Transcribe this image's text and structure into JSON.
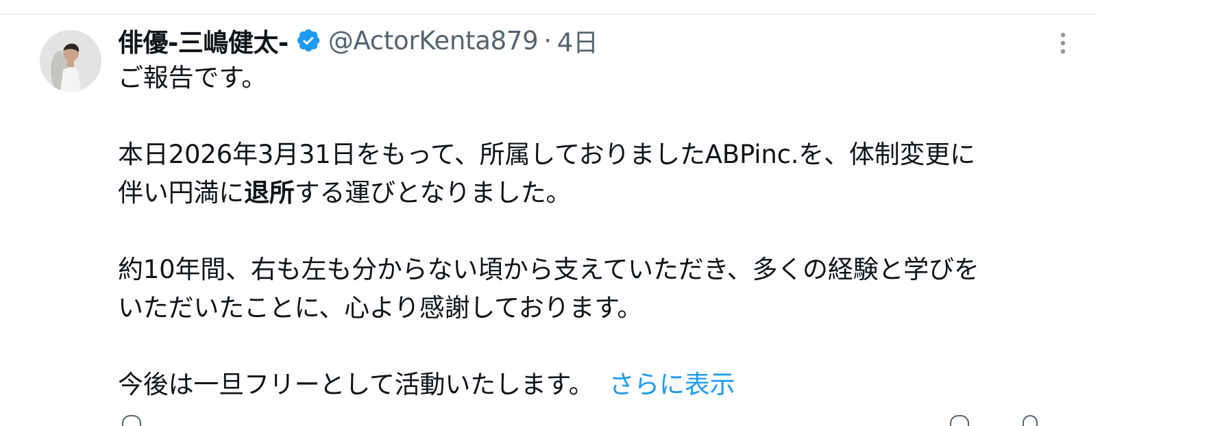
{
  "tweet": {
    "author": {
      "display_name": "俳優-三嶋健太-",
      "verified": true,
      "handle": "@ActorKenta879",
      "separator": "·",
      "timestamp": "4日"
    },
    "body": {
      "line1": "ご報告です。",
      "line2": "本日2026年3月31日をもって、所属しておりましたABPinc.を、体制変更に",
      "line3_pre": "伴い円満に",
      "line3_bold": "退所",
      "line3_post": "する運びとなりました。",
      "line4": "約10年間、右も左も分からない頃から支えていただき、多くの経験と学びを",
      "line5": "いただいたことに、心より感謝しております。",
      "line6": "今後は一旦フリーとして活動いたします。",
      "show_more": "さらに表示"
    },
    "icons": {
      "verified": "verified-badge-icon",
      "more": "more-options-icon"
    },
    "colors": {
      "text": "#0f1419",
      "secondary": "#536471",
      "accent": "#1d9bf0"
    }
  }
}
